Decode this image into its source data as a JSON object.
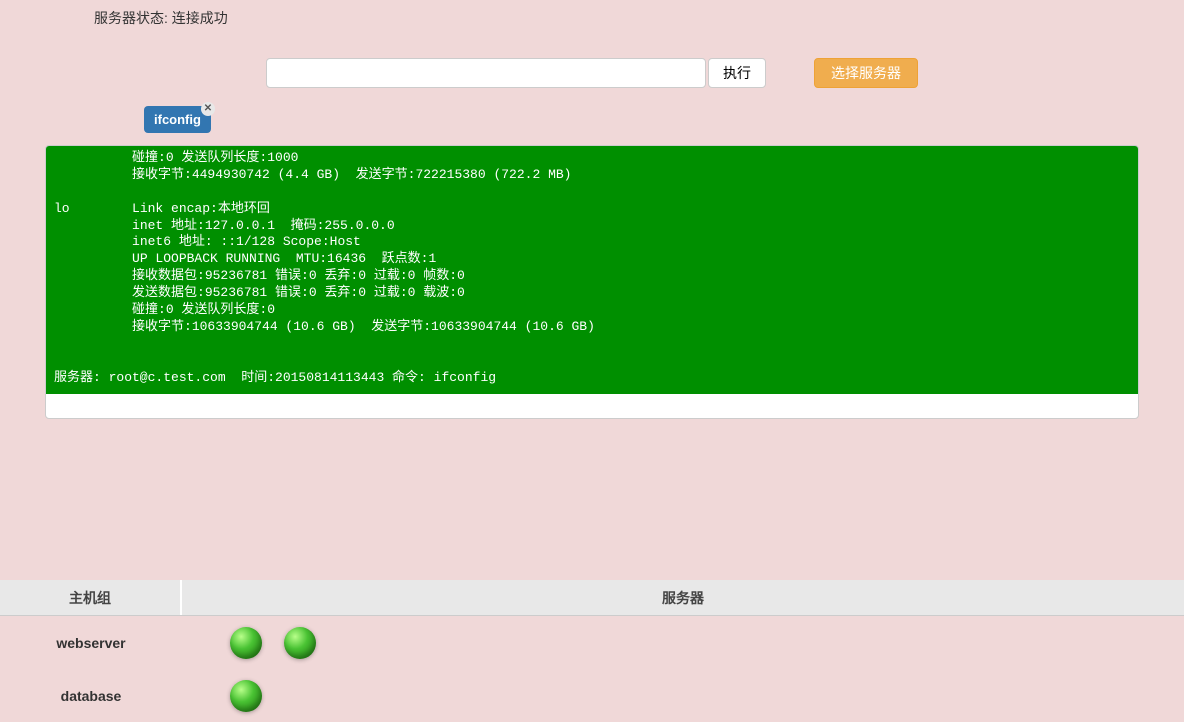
{
  "status_label": "服务器状态:",
  "status_value": "连接成功",
  "command_input": "",
  "exec_label": "执行",
  "select_server_label": "选择服务器",
  "tag_label": "ifconfig",
  "terminal_text": "          碰撞:0 发送队列长度:1000\n          接收字节:4494930742 (4.4 GB)  发送字节:722215380 (722.2 MB)\n\nlo        Link encap:本地环回\n          inet 地址:127.0.0.1  掩码:255.0.0.0\n          inet6 地址: ::1/128 Scope:Host\n          UP LOOPBACK RUNNING  MTU:16436  跃点数:1\n          接收数据包:95236781 错误:0 丢弃:0 过载:0 帧数:0\n          发送数据包:95236781 错误:0 丢弃:0 过载:0 载波:0\n          碰撞:0 发送队列长度:0\n          接收字节:10633904744 (10.6 GB)  发送字节:10633904744 (10.6 GB)\n\n\n服务器: root@c.test.com  时间:20150814113443 命令: ifconfig",
  "hostgroup_header": "主机组",
  "server_header": "服务器",
  "rows": [
    {
      "name": "webserver",
      "servers": 2
    },
    {
      "name": "database",
      "servers": 1
    }
  ]
}
